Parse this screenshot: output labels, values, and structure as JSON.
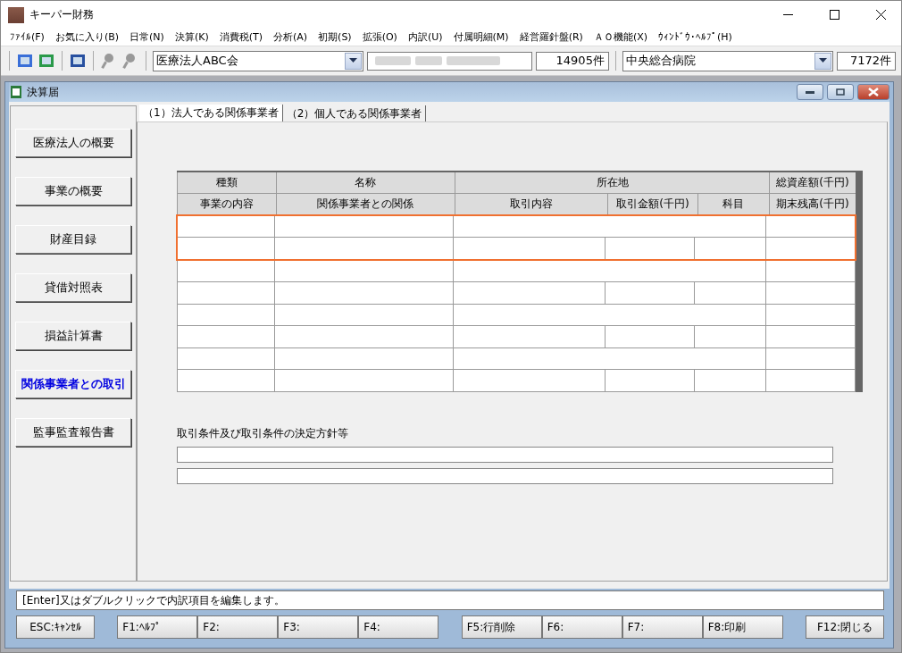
{
  "window": {
    "title": "キーパー財務"
  },
  "menu": [
    "ﾌｧｲﾙ(F)",
    "お気に入り(B)",
    "日常(N)",
    "決算(K)",
    "消費税(T)",
    "分析(A)",
    "初期(S)",
    "拡張(O)",
    "内訳(U)",
    "付属明細(M)",
    "経営羅針盤(R)",
    "ＡＯ機能(X)",
    "ｳｨﾝﾄﾞｳ･ﾍﾙﾌﾟ(H)"
  ],
  "toolbar": {
    "corporation": {
      "value": "医療法人ABC会"
    },
    "corporation_count": "14905件",
    "hospital": {
      "value": "中央総合病院"
    },
    "hospital_count": "7172件"
  },
  "child_window": {
    "title": "決算届"
  },
  "sidebar": [
    {
      "label": "医療法人の概要",
      "selected": false
    },
    {
      "label": "事業の概要",
      "selected": false
    },
    {
      "label": "財産目録",
      "selected": false
    },
    {
      "label": "貸借対照表",
      "selected": false
    },
    {
      "label": "損益計算書",
      "selected": false
    },
    {
      "label": "関係事業者との取引",
      "selected": true
    },
    {
      "label": "監事監査報告書",
      "selected": false
    }
  ],
  "tabs": [
    {
      "label": "（1）法人である関係事業者",
      "selected": true
    },
    {
      "label": "（2）個人である関係事業者",
      "selected": false
    }
  ],
  "table": {
    "header_row_1": [
      "種類",
      "名称",
      "所在地",
      "総資産額(千円)"
    ],
    "header_row_2": [
      "事業の内容",
      "関係事業者との関係",
      "取引内容",
      "取引金額(千円)",
      "科目",
      "期末残高(千円)"
    ],
    "records": [
      {
        "selected": true
      },
      {
        "selected": false
      },
      {
        "selected": false
      },
      {
        "selected": false
      }
    ]
  },
  "conditions": {
    "label": "取引条件及び取引条件の決定方針等"
  },
  "status_bar": "[Enter]又はダブルクリックで内訳項目を編集します。",
  "function_key_groups": [
    [
      "ESC:ｷｬﾝｾﾙ"
    ],
    [
      "F1:ﾍﾙﾌﾟ",
      "F2:",
      "F3:",
      "F4:"
    ],
    [
      "F5:行削除",
      "F6:",
      "F7:",
      "F8:印刷"
    ],
    [
      "F12:閉じる"
    ]
  ]
}
